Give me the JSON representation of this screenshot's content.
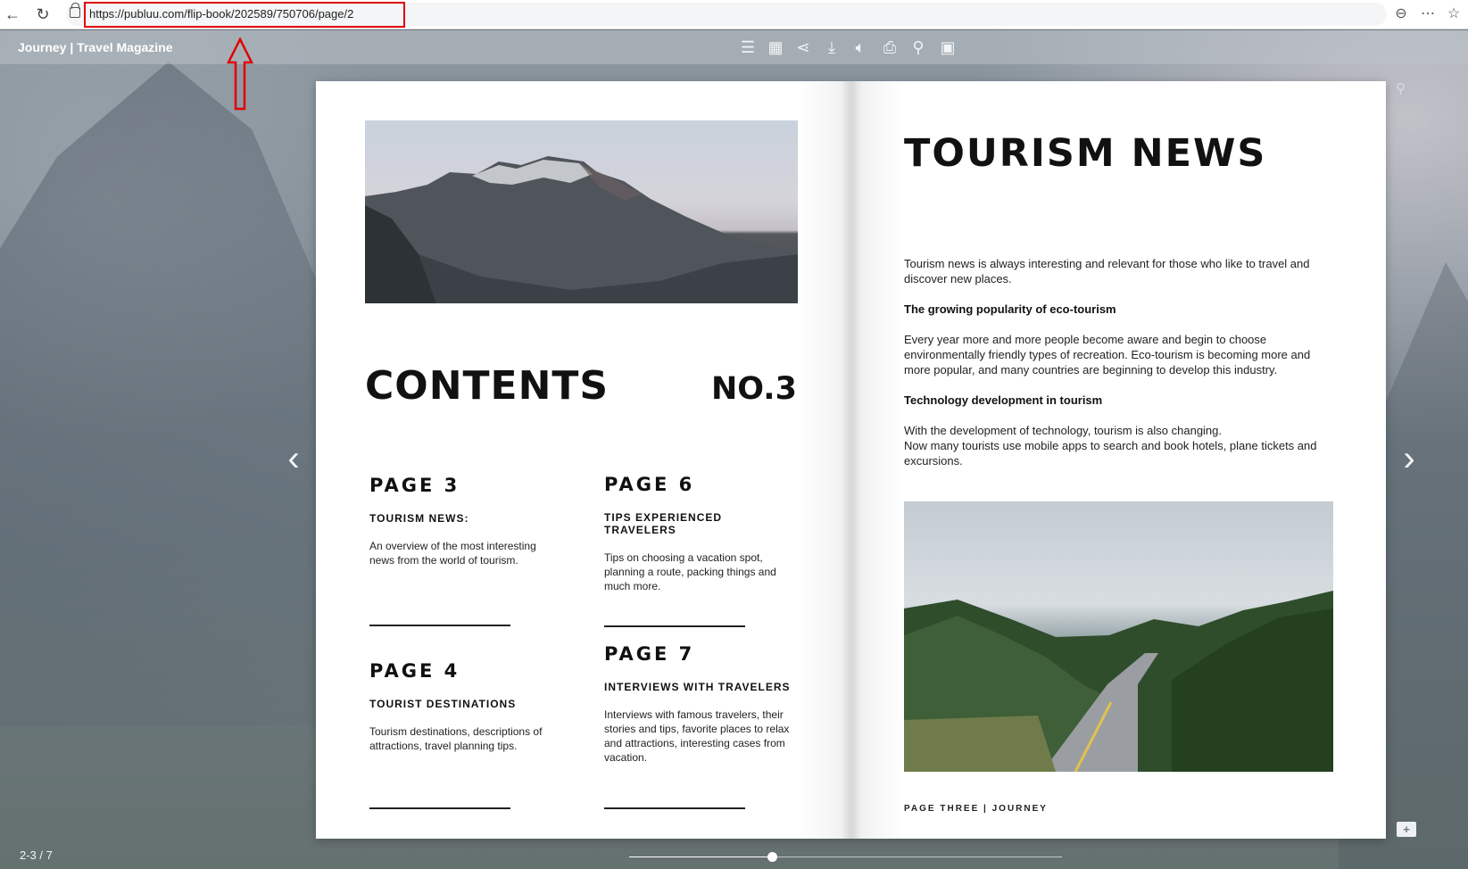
{
  "browser": {
    "url": "https://publuu.com/flip-book/202589/750706/page/2",
    "back_icon": "back-arrow-icon",
    "reload_icon": "reload-icon"
  },
  "reader": {
    "magazine_title": "Journey | Travel Magazine",
    "toolbar": [
      "table-of-contents-icon",
      "grid-icon",
      "share-icon",
      "download-icon",
      "sound-icon",
      "print-icon",
      "zoom-icon",
      "fullscreen-icon"
    ],
    "page_indicator": "2-3 / 7",
    "progress": 0.33
  },
  "left_page": {
    "contents_title": "CONTENTS",
    "issue_no": "NO.3",
    "toc": [
      {
        "page": "PAGE 3",
        "heading": "TOURISM NEWS:",
        "desc": "An overview of the most interesting news from the world of tourism."
      },
      {
        "page": "PAGE 6",
        "heading": "TIPS EXPERIENCED TRAVELERS",
        "desc": "Tips on choosing a vacation spot, planning a route, packing things and much more."
      },
      {
        "page": "PAGE 4",
        "heading": "TOURIST DESTINATIONS",
        "desc": "Tourism destinations, descriptions of attractions, travel planning tips."
      },
      {
        "page": "PAGE 7",
        "heading": "INTERVIEWS WITH TRAVELERS",
        "desc": "Interviews with famous travelers, their stories and tips, favorite places to relax and attractions, interesting cases from vacation."
      }
    ]
  },
  "right_page": {
    "title": "TOURISM NEWS",
    "intro": "Tourism news is always interesting and relevant for those who like to travel and discover new places.",
    "sub1": "The growing popularity of eco-tourism",
    "body1": "Every year more and more people become aware and begin to choose environmentally friendly types of recreation. Eco-tourism is becoming more and more popular, and many countries are beginning to develop this industry.",
    "sub2": "Technology development in tourism",
    "body2a": "With the development of technology, tourism is also changing.",
    "body2b": "Now many tourists use mobile apps to search and book hotels, plane tickets and excursions.",
    "footer": "PAGE THREE | JOURNEY"
  }
}
